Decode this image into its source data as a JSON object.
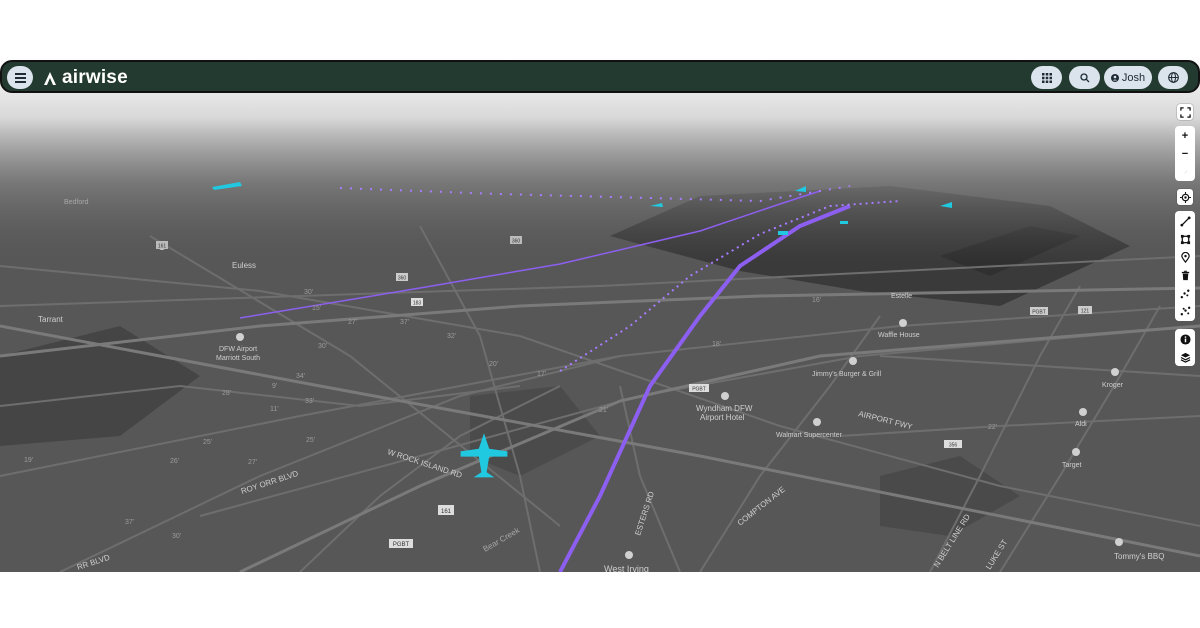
{
  "app": {
    "brand_name": "airwise",
    "user_name": "Josh",
    "colors": {
      "header_bg": "#233a30",
      "pill_bg": "#dbe3ec",
      "track": "#8d5ff0",
      "aircraft": "#20c8e0"
    }
  },
  "header": {
    "menu_icon": "hamburger-icon",
    "logo_icon": "airwise-logo-icon",
    "apps_icon": "grid-icon",
    "search_icon": "search-icon",
    "user_icon": "user-icon",
    "globe_icon": "globe-icon"
  },
  "toolbar": {
    "items": [
      {
        "icon": "fullscreen-icon"
      },
      {
        "icon": "zoom-in-icon",
        "label": "+"
      },
      {
        "icon": "zoom-out-icon",
        "label": "−"
      },
      {
        "icon": "compass-icon"
      },
      {
        "icon": "locate-icon"
      },
      {
        "icon": "draw-line-icon"
      },
      {
        "icon": "draw-polygon-icon"
      },
      {
        "icon": "marker-icon"
      },
      {
        "icon": "trash-icon"
      },
      {
        "icon": "scatter-icon"
      },
      {
        "icon": "scatter-alt-icon"
      },
      {
        "icon": "info-icon"
      },
      {
        "icon": "layers-icon"
      }
    ]
  },
  "map": {
    "places": {
      "bedford": "Bedford",
      "euless": "Euless",
      "tarrant": "Tarrant",
      "dfw_airport_marriott_1": "DFW Airport",
      "dfw_airport_marriott_2": "Marriott South",
      "estelle": "Estelle",
      "waffle_house": "Waffle House",
      "jimmys": "Jimmy's Burger & Grill",
      "kroger": "Kroger",
      "aldi": "Aldi",
      "target": "Target",
      "wyndham_1": "Wyndham DFW",
      "wyndham_2": "Airport Hotel",
      "walmart": "Walmart Supercenter",
      "tommys": "Tommy's BBQ",
      "west_irving": "West Irving"
    },
    "roads": {
      "airport_fwy": "AIRPORT FWY",
      "rock_island": "W ROCK ISLAND RD",
      "roy_orr": "ROY ORR BLVD",
      "bear_creek": "Bear Creek",
      "esters": "ESTERS RD",
      "compton": "COMPTON AVE",
      "belt_line": "N BELT LINE RD",
      "luke": "LUKE ST",
      "orr_blvd": "RR BLVD"
    },
    "shields": [
      "183",
      "161",
      "PGBT",
      "PGBT",
      "360",
      "356",
      "360",
      "121",
      "PGBT",
      "161"
    ],
    "elevations": [
      "30'",
      "15'",
      "27'",
      "30'",
      "32'",
      "37'",
      "17'",
      "21'",
      "34'",
      "20'",
      "33'",
      "28'",
      "11'",
      "9'",
      "25'",
      "26'",
      "27'",
      "19'",
      "25'",
      "37'",
      "30'",
      "22'",
      "18'",
      "16'"
    ]
  }
}
